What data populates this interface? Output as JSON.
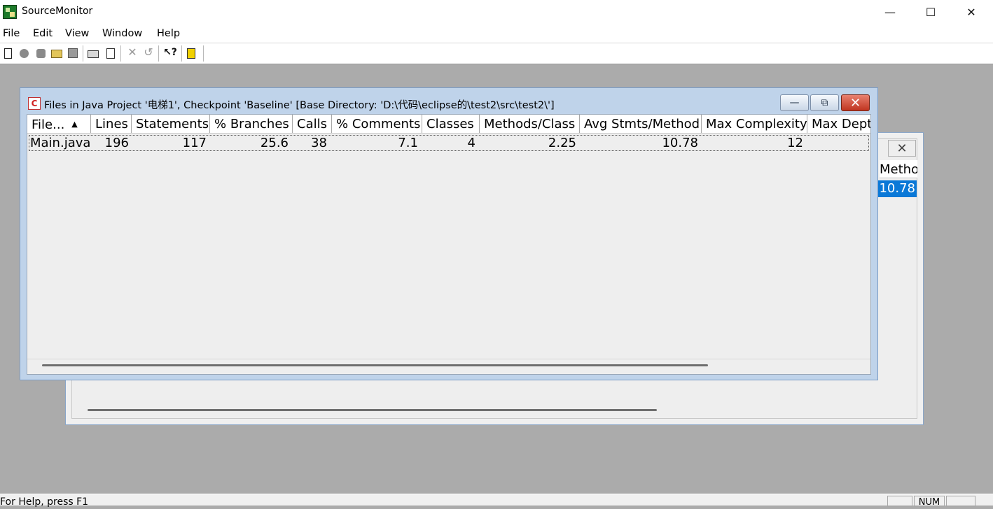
{
  "app": {
    "title": "SourceMonitor",
    "icon": "source-monitor-app-icon",
    "window_controls": {
      "minimize": "—",
      "maximize": "☐",
      "close": "✕"
    }
  },
  "menu": [
    "File",
    "Edit",
    "View",
    "Window",
    "Help"
  ],
  "toolbar": {
    "buttons": [
      "new-icon",
      "stop-icon",
      "record-icon",
      "open-folder-icon",
      "save-icon",
      "print-icon",
      "print-preview-icon",
      "delete-icon",
      "undo-icon",
      "context-help-icon",
      "alert-icon"
    ]
  },
  "front_window": {
    "title": "Files in Java Project '电梯1', Checkpoint 'Baseline'  [Base Directory: 'D:\\代码\\eclipse的\\test2\\src\\test2\\']",
    "icon_letter": "C",
    "controls": {
      "minimize": "—",
      "restore": "⧉",
      "close": "✕"
    },
    "columns": [
      "File...",
      "Lines",
      "Statements",
      "% Branches",
      "Calls",
      "% Comments",
      "Classes",
      "Methods/Class",
      "Avg Stmts/Method",
      "Max Complexity",
      "Max Dept"
    ],
    "sort_indicator": "▲",
    "rows": [
      {
        "file": "Main.java",
        "lines": "196",
        "statements": "117",
        "branches": "25.6",
        "calls": "38",
        "comments": "7.1",
        "classes": "4",
        "methods_class": "2.25",
        "avg_stmts": "10.78",
        "max_complexity": "12"
      }
    ]
  },
  "back_window": {
    "close": "✕",
    "column_header_fragment": "Method",
    "selected_value_fragment": "10.78"
  },
  "status": {
    "text": "For Help, press F1",
    "num": "NUM"
  },
  "colors": {
    "workspace": "#ababab",
    "selection": "#0a78d7",
    "close_button": "#c03420"
  }
}
